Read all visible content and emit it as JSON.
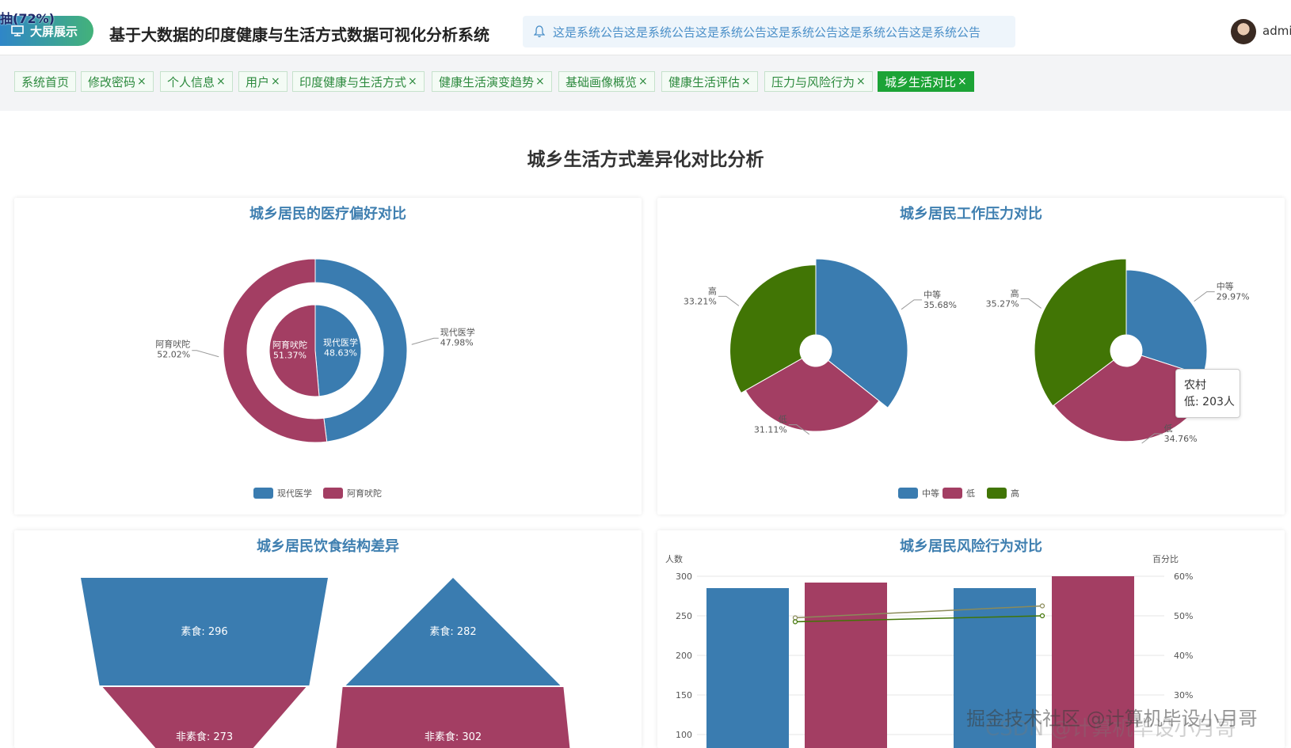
{
  "header": {
    "overlay_text": "抽(72%)",
    "bigscreen_label": "大屏展示",
    "title": "基于大数据的印度健康与生活方式数据可视化分析系统",
    "notice": "这是系统公告这是系统公告这是系统公告这是系统公告这是系统公告这是系统公告",
    "user": "admi"
  },
  "tabs": [
    {
      "label": "系统首页",
      "closable": false
    },
    {
      "label": "修改密码",
      "closable": true
    },
    {
      "label": "个人信息",
      "closable": true
    },
    {
      "label": "用户",
      "closable": true
    },
    {
      "label": "印度健康与生活方式",
      "closable": true
    },
    {
      "label": "健康生活演变趋势",
      "closable": true
    },
    {
      "label": "基础画像概览",
      "closable": true
    },
    {
      "label": "健康生活评估",
      "closable": true
    },
    {
      "label": "压力与风险行为",
      "closable": true
    },
    {
      "label": "城乡生活对比",
      "closable": true,
      "active": true
    }
  ],
  "tab_close_glyph": "×",
  "page_title": "城乡生活方式差异化对比分析",
  "colors": {
    "blue": "#3a7cb0",
    "red": "#a33e63",
    "green": "#417505",
    "accent": "#1ca336"
  },
  "tooltip": {
    "line1": "农村",
    "line2": "低: 203人"
  },
  "watermark": {
    "line1": "掘金技术社区 @计算机毕设小月哥",
    "line2": "CSDN @计算机毕设小月哥"
  },
  "chart_data": [
    {
      "type": "pie",
      "title": "城乡居民的医疗偏好对比",
      "legend": [
        "现代医学",
        "阿育吠陀"
      ],
      "series": [
        {
          "name": "inner",
          "slices": [
            {
              "label": "现代医学",
              "value": 48.63,
              "text": "48.63%"
            },
            {
              "label": "阿育吠陀",
              "value": 51.37,
              "text": "51.37%"
            }
          ]
        },
        {
          "name": "outer",
          "slices": [
            {
              "label": "现代医学",
              "value": 47.98,
              "text": "47.98%"
            },
            {
              "label": "阿育吠陀",
              "value": 52.02,
              "text": "52.02%"
            }
          ]
        }
      ]
    },
    {
      "type": "pie",
      "title": "城乡居民工作压力对比",
      "legend": [
        "中等",
        "低",
        "高"
      ],
      "series": [
        {
          "name": "left",
          "slices": [
            {
              "label": "中等",
              "value": 35.68,
              "text": "35.68%"
            },
            {
              "label": "低",
              "value": 31.11,
              "text": "31.11%"
            },
            {
              "label": "高",
              "value": 33.21,
              "text": "33.21%"
            }
          ]
        },
        {
          "name": "right",
          "slices": [
            {
              "label": "中等",
              "value": 29.97,
              "text": "29.97%"
            },
            {
              "label": "低",
              "value": 34.76,
              "text": "34.76%"
            },
            {
              "label": "高",
              "value": 35.27,
              "text": "35.27%"
            }
          ]
        }
      ]
    },
    {
      "type": "funnel",
      "title": "城乡居民饮食结构差异",
      "series": [
        {
          "name": "left",
          "items": [
            {
              "label": "素食",
              "value": 296,
              "text": "素食: 296"
            },
            {
              "label": "非素食",
              "value": 273,
              "text": "非素食: 273"
            }
          ]
        },
        {
          "name": "right",
          "items": [
            {
              "label": "素食",
              "value": 282,
              "text": "素食: 282"
            },
            {
              "label": "非素食",
              "value": 302,
              "text": "非素食: 302"
            }
          ]
        }
      ]
    },
    {
      "type": "bar",
      "title": "城乡居民风险行为对比",
      "ylabel": "人数",
      "y2label": "百分比",
      "yticks": [
        "300",
        "250",
        "200",
        "150",
        "100"
      ],
      "y2ticks": [
        "60%",
        "50%",
        "40%",
        "30%"
      ],
      "ylim": [
        50,
        300
      ],
      "y2lim": [
        10,
        60
      ],
      "groups": [
        {
          "bars": [
            285,
            292
          ]
        },
        {
          "bars": [
            285,
            300
          ]
        }
      ],
      "lines": [
        {
          "values": [
            49.5,
            52.5
          ]
        },
        {
          "values": [
            48.5,
            50.0
          ]
        }
      ]
    }
  ]
}
